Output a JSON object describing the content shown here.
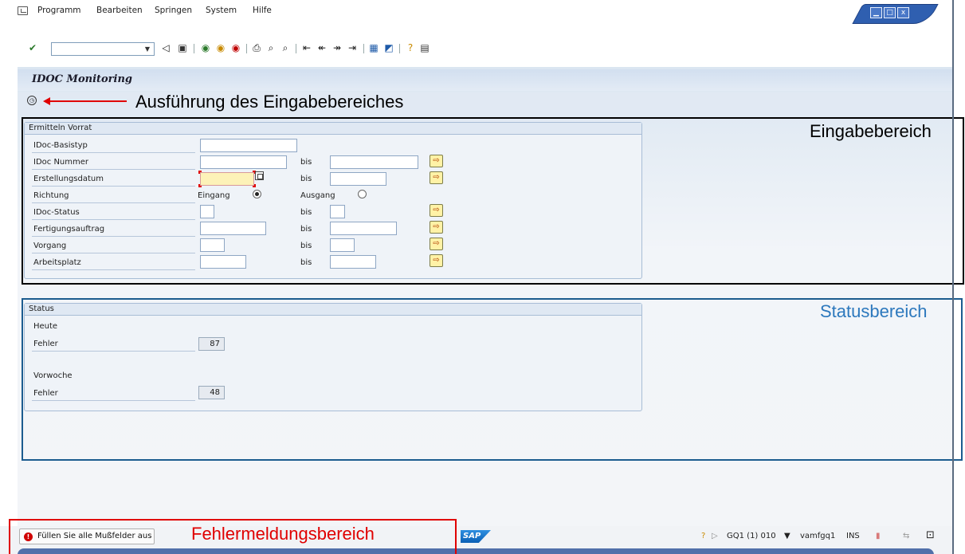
{
  "menu": {
    "items": [
      "Programm",
      "Bearbeiten",
      "Springen",
      "System",
      "Hilfe"
    ]
  },
  "window_buttons": [
    "▁",
    "□",
    "x"
  ],
  "toolbar": {
    "command_field_value": "",
    "icons": [
      "enter-check-icon",
      "back-icon",
      "save-icon",
      "back-green-icon",
      "exit-icon",
      "cancel-icon",
      "print-icon",
      "find-icon",
      "find-next-icon",
      "first-page-icon",
      "previous-page-icon",
      "next-page-icon",
      "last-page-icon",
      "create-session-icon",
      "shortcut-icon",
      "help-icon",
      "layout-menu-icon"
    ]
  },
  "screen": {
    "title": "IDOC Monitoring"
  },
  "annotations": {
    "exec": "Ausführung des Eingabebereiches",
    "eingabe": "Eingabebereich",
    "status": "Statusbereich",
    "fehler": "Fehlermeldungsbereich"
  },
  "input_group": {
    "title": "Ermitteln Vorrat",
    "fields": {
      "basistyp": "IDoc-Basistyp",
      "nummer": "IDoc Nummer",
      "datum": "Erstellungsdatum",
      "richtung": "Richtung",
      "status": "IDoc-Status",
      "auftrag": "Fertigungsauftrag",
      "vorgang": "Vorgang",
      "arbeitsplatz": "Arbeitsplatz"
    },
    "bis": "bis",
    "eingang": "Eingang",
    "ausgang": "Ausgang",
    "direction_selected": "Eingang"
  },
  "status_group": {
    "title": "Status",
    "heute": "Heute",
    "vorwoche": "Vorwoche",
    "fehler_label": "Fehler",
    "heute_fehler": "87",
    "vorwoche_fehler": "48"
  },
  "statusbar": {
    "message": "Füllen Sie alle Mußfelder aus",
    "sap_logo": "SAP",
    "system": "GQ1 (1) 010",
    "server": "vamfgq1",
    "mode": "INS"
  },
  "colors": {
    "annotation_red": "#e00000",
    "annotation_blue": "#2c78bd",
    "required_field": "#fdf2b8"
  }
}
